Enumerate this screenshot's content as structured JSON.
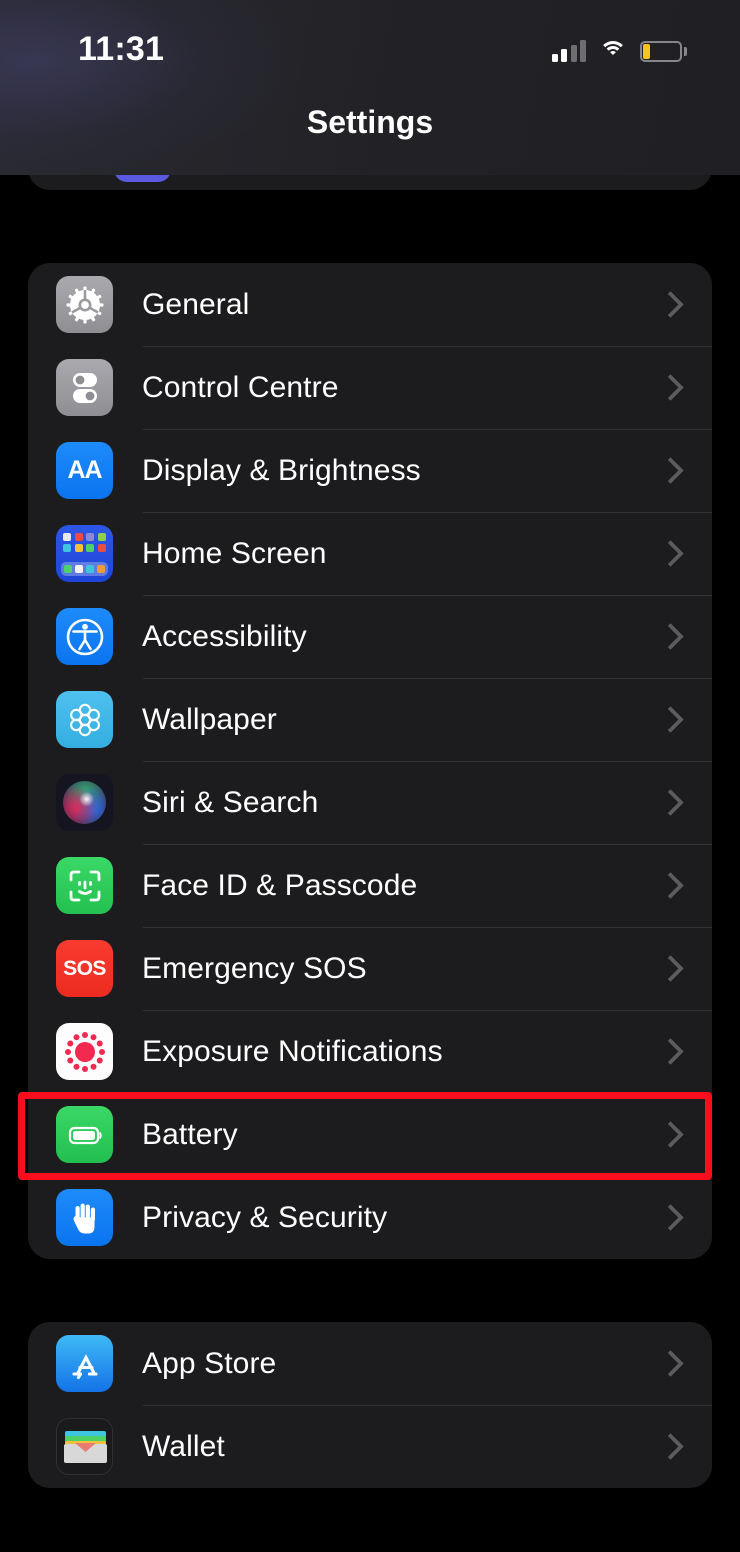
{
  "status_bar": {
    "time": "11:31",
    "signal_icon": "cellular-signal-icon",
    "signal_bars_filled": 2,
    "signal_bars_total": 4,
    "wifi_icon": "wifi-icon",
    "battery_icon": "battery-icon",
    "battery_level_percent": 20,
    "battery_fill_color": "#f5c518"
  },
  "header": {
    "title": "Settings"
  },
  "highlight": {
    "target_row": "Battery",
    "color": "#fb0d1b"
  },
  "groups": [
    {
      "name": "main-settings-group",
      "rows": [
        {
          "label": "General",
          "icon": "gear-icon",
          "chevron": "chevron-right-icon"
        },
        {
          "label": "Control Centre",
          "icon": "toggles-icon",
          "chevron": "chevron-right-icon"
        },
        {
          "label": "Display & Brightness",
          "icon": "text-size-aa-icon",
          "chevron": "chevron-right-icon"
        },
        {
          "label": "Home Screen",
          "icon": "app-grid-icon",
          "chevron": "chevron-right-icon"
        },
        {
          "label": "Accessibility",
          "icon": "accessibility-person-icon",
          "chevron": "chevron-right-icon"
        },
        {
          "label": "Wallpaper",
          "icon": "flower-icon",
          "chevron": "chevron-right-icon"
        },
        {
          "label": "Siri & Search",
          "icon": "siri-orb-icon",
          "chevron": "chevron-right-icon"
        },
        {
          "label": "Face ID & Passcode",
          "icon": "face-id-icon",
          "chevron": "chevron-right-icon"
        },
        {
          "label": "Emergency SOS",
          "icon": "sos-icon",
          "chevron": "chevron-right-icon"
        },
        {
          "label": "Exposure Notifications",
          "icon": "exposure-dots-icon",
          "chevron": "chevron-right-icon"
        },
        {
          "label": "Battery",
          "icon": "battery-green-icon",
          "chevron": "chevron-right-icon"
        },
        {
          "label": "Privacy & Security",
          "icon": "hand-icon",
          "chevron": "chevron-right-icon"
        }
      ]
    },
    {
      "name": "apps-group",
      "rows": [
        {
          "label": "App Store",
          "icon": "app-store-icon",
          "chevron": "chevron-right-icon"
        },
        {
          "label": "Wallet",
          "icon": "wallet-icon",
          "chevron": "chevron-right-icon"
        }
      ]
    }
  ]
}
